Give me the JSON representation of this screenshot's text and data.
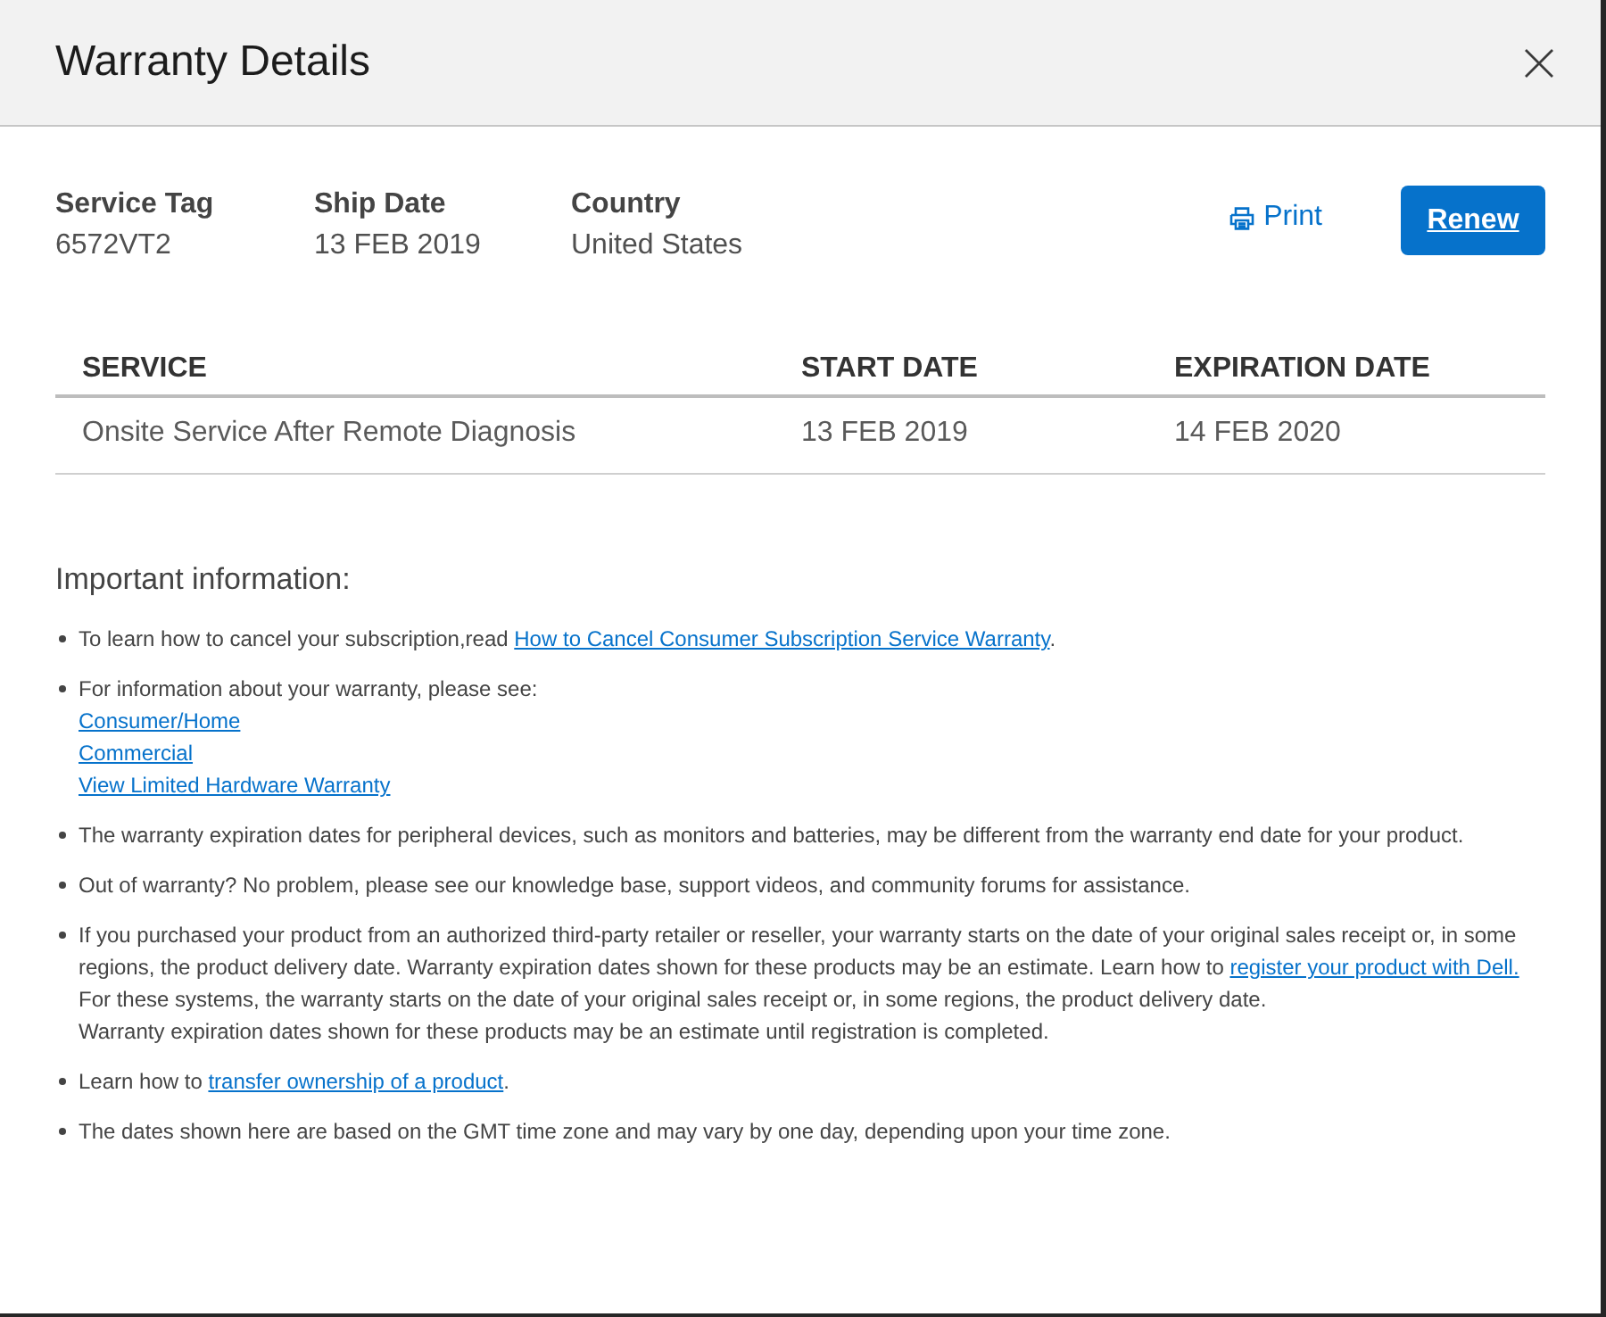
{
  "dialog": {
    "title": "Warranty Details"
  },
  "summary": [
    {
      "label": "Service Tag",
      "value": "6572VT2"
    },
    {
      "label": "Ship Date",
      "value": "13 FEB 2019"
    },
    {
      "label": "Country",
      "value": "United States"
    }
  ],
  "actions": [
    {
      "kind": "icon_link",
      "label": "Print"
    },
    {
      "kind": "primary_button",
      "label": "Renew"
    }
  ],
  "table": {
    "columns": [
      "SERVICE",
      "START DATE",
      "EXPIRATION DATE"
    ],
    "rows": [
      [
        "Onsite Service After Remote Diagnosis",
        "13 FEB 2019",
        "14 FEB 2020"
      ]
    ]
  },
  "important_information": {
    "heading": "Important information:",
    "items": [
      {
        "paragraphs": [
          [
            {
              "kind": "text",
              "text": "To learn how to cancel your subscription,read "
            },
            {
              "kind": "link",
              "text": "How to Cancel Consumer Subscription Service Warranty"
            },
            {
              "kind": "text",
              "text": "."
            }
          ]
        ]
      },
      {
        "paragraphs": [
          [
            {
              "kind": "text",
              "text": "For information about your warranty, please see:"
            }
          ],
          [
            {
              "kind": "link",
              "text": "Consumer/Home"
            }
          ],
          [
            {
              "kind": "link",
              "text": "Commercial"
            }
          ],
          [
            {
              "kind": "link",
              "text": "View Limited Hardware Warranty"
            }
          ]
        ]
      },
      {
        "paragraphs": [
          [
            {
              "kind": "text",
              "text": "The warranty expiration dates for peripheral devices, such as monitors and batteries, may be different from the warranty end date for your product."
            }
          ]
        ]
      },
      {
        "paragraphs": [
          [
            {
              "kind": "text",
              "text": "Out of warranty? No problem, please see our knowledge base, support videos, and community forums for assistance."
            }
          ]
        ]
      },
      {
        "paragraphs": [
          [
            {
              "kind": "text",
              "text": "If you purchased your product from an authorized third-party retailer or reseller, your warranty starts on the date of your original sales receipt or, in some regions, the product delivery date. Warranty expiration dates shown for these products may be an estimate. Learn how to "
            },
            {
              "kind": "link",
              "text": "register your product with Dell."
            }
          ],
          [
            {
              "kind": "text",
              "text": "For these systems, the warranty starts on the date of your original sales receipt or, in some regions, the product delivery date."
            }
          ],
          [
            {
              "kind": "text",
              "text": "Warranty expiration dates shown for these products may be an estimate until registration is completed."
            }
          ]
        ]
      },
      {
        "paragraphs": [
          [
            {
              "kind": "text",
              "text": "Learn how to "
            },
            {
              "kind": "link",
              "text": "transfer ownership of a product"
            },
            {
              "kind": "text",
              "text": "."
            }
          ]
        ]
      },
      {
        "paragraphs": [
          [
            {
              "kind": "text",
              "text": "The dates shown here are based on the GMT time zone and may vary by one day, depending upon your time zone."
            }
          ]
        ]
      }
    ]
  }
}
